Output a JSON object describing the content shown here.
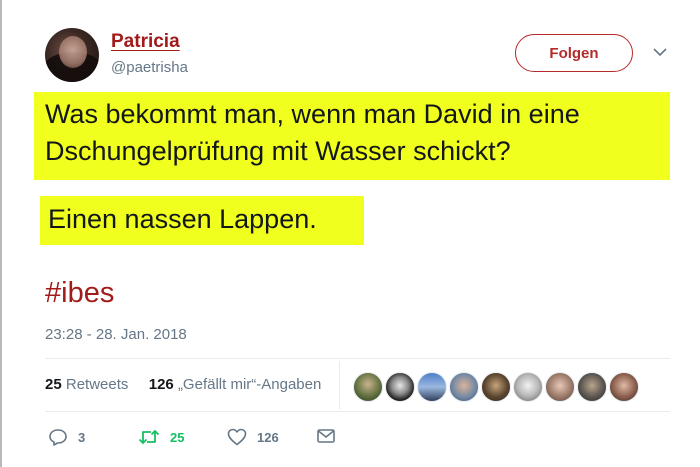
{
  "user": {
    "name": "Patricia",
    "handle": "@paetrisha"
  },
  "follow_button": {
    "label": "Folgen"
  },
  "tweet": {
    "line1": "Was bekommt man, wenn man David in eine",
    "line2": "Dschungelprüfung mit Wasser schickt?",
    "line3": "Einen nassen Lappen.",
    "hashtag": "#ibes",
    "highlight_color": "#f0ff1e"
  },
  "timestamp": "23:28 - 28. Jan. 2018",
  "stats": {
    "retweets_count": "25",
    "retweets_label": "Retweets",
    "likes_count": "126",
    "likes_label": "„Gefällt mir“-Angaben"
  },
  "actions": {
    "reply_count": "3",
    "retweet_count": "25",
    "like_count": "126"
  },
  "colors": {
    "accent": "#a11b1b",
    "retweet_green": "#17bf63",
    "muted": "#657786"
  }
}
